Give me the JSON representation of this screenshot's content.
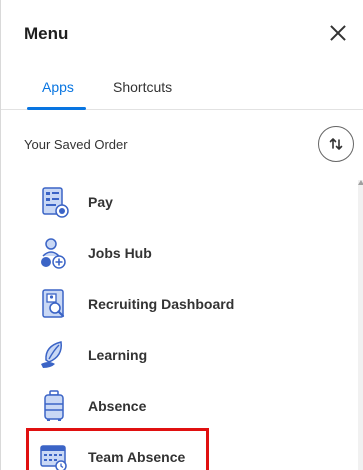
{
  "header": {
    "title": "Menu"
  },
  "tabs": [
    {
      "label": "Apps",
      "active": true
    },
    {
      "label": "Shortcuts",
      "active": false
    }
  ],
  "saved_order": {
    "label": "Your Saved Order"
  },
  "apps": [
    {
      "label": "Pay",
      "icon": "pay-icon"
    },
    {
      "label": "Jobs Hub",
      "icon": "jobs-hub-icon"
    },
    {
      "label": "Recruiting Dashboard",
      "icon": "recruiting-dashboard-icon"
    },
    {
      "label": "Learning",
      "icon": "learning-icon"
    },
    {
      "label": "Absence",
      "icon": "absence-icon"
    },
    {
      "label": "Team Absence",
      "icon": "team-absence-icon"
    }
  ],
  "colors": {
    "accent": "#0875e1",
    "highlight": "#e01010",
    "icon_primary": "#3b64c6",
    "icon_light": "#c9d8f5"
  }
}
